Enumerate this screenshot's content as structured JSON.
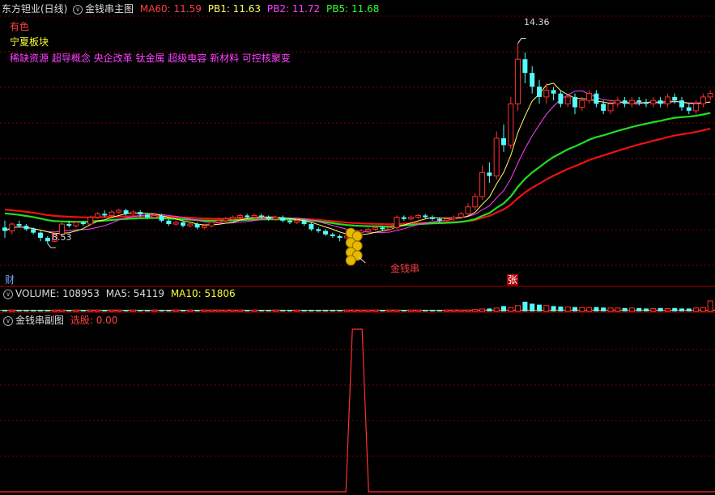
{
  "header": {
    "stock_title": "东方钽业(日线)",
    "main_indicator": "金钱串主图",
    "ma60_label": "MA60: 11.59",
    "pb1_label": "PB1: 11.63",
    "pb2_label": "PB2: 11.72",
    "pb5_label": "PB5: 11.68"
  },
  "info": {
    "line1": "有色",
    "line2": "宁夏板块",
    "line3": "稀缺资源 超导概念 央企改革 钛金属 超级电容 新材料 可控核聚变"
  },
  "annotations": {
    "high_label": "14.36",
    "low_label": "8.53",
    "signal_label": "金钱串",
    "fin_marker": "财",
    "zhang_marker": "张"
  },
  "volume_header": {
    "volume_label": "VOLUME: 108953",
    "ma5_label": "MA5: 54119",
    "ma10_label": "MA10: 51806"
  },
  "sub_header": {
    "title": "金钱串副图",
    "signal_label": "选股: 0.00"
  },
  "colors": {
    "background": "#000000",
    "grid": "#7a0000",
    "up": "#ff3030",
    "down": "#54fcfc",
    "ma60": "#ff2020",
    "pb1": "#ffff66",
    "pb2": "#ff40ff",
    "pb5": "#00ff00",
    "slow_green": "#22dd22",
    "slow_red": "#ee1111",
    "coin": "#e6b800"
  },
  "chart_data": {
    "type": "candlestick",
    "price_range": [
      7.9,
      15.2
    ],
    "high": 14.36,
    "low": 8.53,
    "candles": [
      [
        9.0,
        8.9,
        9.2,
        8.7
      ],
      [
        8.9,
        9.1,
        9.15,
        8.8
      ],
      [
        9.1,
        9.05,
        9.2,
        9.0
      ],
      [
        9.05,
        8.95,
        9.1,
        8.9
      ],
      [
        8.95,
        8.85,
        9.0,
        8.8
      ],
      [
        8.85,
        8.7,
        8.9,
        8.6
      ],
      [
        8.7,
        8.6,
        8.75,
        8.53
      ],
      [
        8.6,
        8.8,
        8.85,
        8.58
      ],
      [
        8.8,
        9.1,
        9.15,
        8.75
      ],
      [
        9.1,
        9.05,
        9.2,
        9.0
      ],
      [
        9.05,
        9.15,
        9.2,
        9.0
      ],
      [
        9.15,
        9.1,
        9.2,
        9.05
      ],
      [
        9.1,
        9.3,
        9.35,
        9.05
      ],
      [
        9.3,
        9.4,
        9.45,
        9.25
      ],
      [
        9.4,
        9.35,
        9.5,
        9.3
      ],
      [
        9.35,
        9.45,
        9.5,
        9.3
      ],
      [
        9.45,
        9.5,
        9.55,
        9.4
      ],
      [
        9.5,
        9.4,
        9.55,
        9.35
      ],
      [
        9.4,
        9.45,
        9.5,
        9.35
      ],
      [
        9.45,
        9.38,
        9.5,
        9.3
      ],
      [
        9.38,
        9.3,
        9.42,
        9.25
      ],
      [
        9.3,
        9.35,
        9.4,
        9.25
      ],
      [
        9.35,
        9.2,
        9.4,
        9.15
      ],
      [
        9.2,
        9.1,
        9.25,
        9.05
      ],
      [
        9.1,
        9.15,
        9.2,
        9.05
      ],
      [
        9.15,
        9.05,
        9.2,
        9.0
      ],
      [
        9.05,
        9.1,
        9.15,
        9.0
      ],
      [
        9.1,
        9.0,
        9.15,
        8.95
      ],
      [
        9.0,
        9.05,
        9.1,
        8.95
      ],
      [
        9.05,
        9.15,
        9.2,
        9.0
      ],
      [
        9.15,
        9.2,
        9.25,
        9.1
      ],
      [
        9.2,
        9.25,
        9.3,
        9.15
      ],
      [
        9.25,
        9.3,
        9.35,
        9.2
      ],
      [
        9.3,
        9.35,
        9.4,
        9.25
      ],
      [
        9.35,
        9.3,
        9.4,
        9.25
      ],
      [
        9.3,
        9.35,
        9.4,
        9.25
      ],
      [
        9.35,
        9.3,
        9.4,
        9.25
      ],
      [
        9.3,
        9.25,
        9.35,
        9.2
      ],
      [
        9.25,
        9.3,
        9.35,
        9.2
      ],
      [
        9.3,
        9.2,
        9.35,
        9.15
      ],
      [
        9.2,
        9.15,
        9.25,
        9.1
      ],
      [
        9.15,
        9.2,
        9.25,
        9.1
      ],
      [
        9.2,
        9.1,
        9.25,
        9.05
      ],
      [
        9.1,
        8.95,
        9.15,
        8.9
      ],
      [
        8.95,
        8.9,
        9.0,
        8.85
      ],
      [
        8.9,
        8.8,
        8.95,
        8.75
      ],
      [
        8.8,
        8.75,
        8.85,
        8.7
      ],
      [
        8.75,
        8.7,
        8.8,
        8.6
      ],
      [
        8.7,
        8.75,
        8.8,
        8.65
      ],
      [
        8.75,
        8.85,
        8.9,
        8.7
      ],
      [
        8.85,
        8.9,
        8.95,
        8.8
      ],
      [
        8.9,
        8.95,
        9.0,
        8.85
      ],
      [
        8.95,
        9.0,
        9.05,
        8.9
      ],
      [
        9.0,
        8.95,
        9.05,
        8.9
      ],
      [
        8.95,
        9.0,
        9.05,
        8.9
      ],
      [
        9.0,
        9.3,
        9.35,
        8.95
      ],
      [
        9.3,
        9.25,
        9.35,
        9.2
      ],
      [
        9.25,
        9.3,
        9.35,
        9.2
      ],
      [
        9.3,
        9.35,
        9.4,
        9.25
      ],
      [
        9.35,
        9.3,
        9.4,
        9.25
      ],
      [
        9.3,
        9.25,
        9.35,
        9.2
      ],
      [
        9.25,
        9.2,
        9.3,
        9.15
      ],
      [
        9.2,
        9.25,
        9.3,
        9.15
      ],
      [
        9.25,
        9.3,
        9.35,
        9.2
      ],
      [
        9.3,
        9.4,
        9.45,
        9.25
      ],
      [
        9.4,
        9.6,
        9.7,
        9.35
      ],
      [
        9.6,
        9.9,
        10.0,
        9.5
      ],
      [
        9.9,
        10.6,
        10.8,
        9.8
      ],
      [
        10.6,
        10.5,
        10.9,
        10.3
      ],
      [
        10.5,
        11.6,
        11.8,
        10.4
      ],
      [
        11.6,
        11.4,
        12.0,
        11.2
      ],
      [
        11.4,
        12.6,
        12.8,
        11.3
      ],
      [
        12.6,
        13.9,
        14.36,
        12.4
      ],
      [
        13.9,
        13.5,
        14.1,
        13.2
      ],
      [
        13.5,
        13.1,
        13.7,
        12.9
      ],
      [
        13.1,
        12.8,
        13.3,
        12.6
      ],
      [
        12.8,
        13.0,
        13.2,
        12.6
      ],
      [
        13.0,
        12.9,
        13.1,
        12.7
      ],
      [
        12.9,
        12.6,
        13.0,
        12.5
      ],
      [
        12.6,
        12.8,
        12.9,
        12.5
      ],
      [
        12.8,
        12.5,
        12.9,
        12.3
      ],
      [
        12.5,
        12.7,
        12.8,
        12.4
      ],
      [
        12.7,
        12.9,
        13.0,
        12.6
      ],
      [
        12.9,
        12.6,
        13.0,
        12.5
      ],
      [
        12.6,
        12.4,
        12.7,
        12.3
      ],
      [
        12.4,
        12.6,
        12.7,
        12.3
      ],
      [
        12.6,
        12.7,
        12.8,
        12.5
      ],
      [
        12.7,
        12.6,
        12.8,
        12.5
      ],
      [
        12.6,
        12.7,
        12.8,
        12.5
      ],
      [
        12.7,
        12.65,
        12.8,
        12.55
      ],
      [
        12.65,
        12.6,
        12.75,
        12.5
      ],
      [
        12.6,
        12.7,
        12.8,
        12.5
      ],
      [
        12.7,
        12.6,
        12.8,
        12.5
      ],
      [
        12.6,
        12.8,
        12.9,
        12.5
      ],
      [
        12.8,
        12.7,
        12.9,
        12.6
      ],
      [
        12.7,
        12.5,
        12.8,
        12.4
      ],
      [
        12.5,
        12.4,
        12.6,
        12.3
      ],
      [
        12.4,
        12.6,
        12.7,
        12.3
      ],
      [
        12.6,
        12.8,
        12.9,
        12.5
      ],
      [
        12.8,
        12.9,
        13.0,
        12.7
      ]
    ],
    "volume": [
      15,
      15,
      15,
      15,
      15,
      15,
      15,
      15,
      15,
      15,
      15,
      15,
      15,
      15,
      15,
      15,
      15,
      15,
      15,
      15,
      15,
      15,
      15,
      15,
      15,
      15,
      15,
      15,
      15,
      15,
      15,
      15,
      15,
      15,
      15,
      15,
      15,
      15,
      15,
      15,
      15,
      15,
      15,
      15,
      15,
      15,
      15,
      15,
      15,
      15,
      15,
      15,
      15,
      15,
      15,
      15,
      15,
      15,
      15,
      15,
      15,
      15,
      15,
      15,
      15,
      15,
      20,
      25,
      30,
      35,
      55,
      40,
      60,
      100,
      80,
      70,
      60,
      55,
      50,
      45,
      45,
      40,
      40,
      45,
      40,
      35,
      35,
      35,
      35,
      35,
      30,
      30,
      35,
      30,
      35,
      30,
      30,
      35,
      40,
      109
    ],
    "signal_index": 49,
    "signal_value": 1
  }
}
